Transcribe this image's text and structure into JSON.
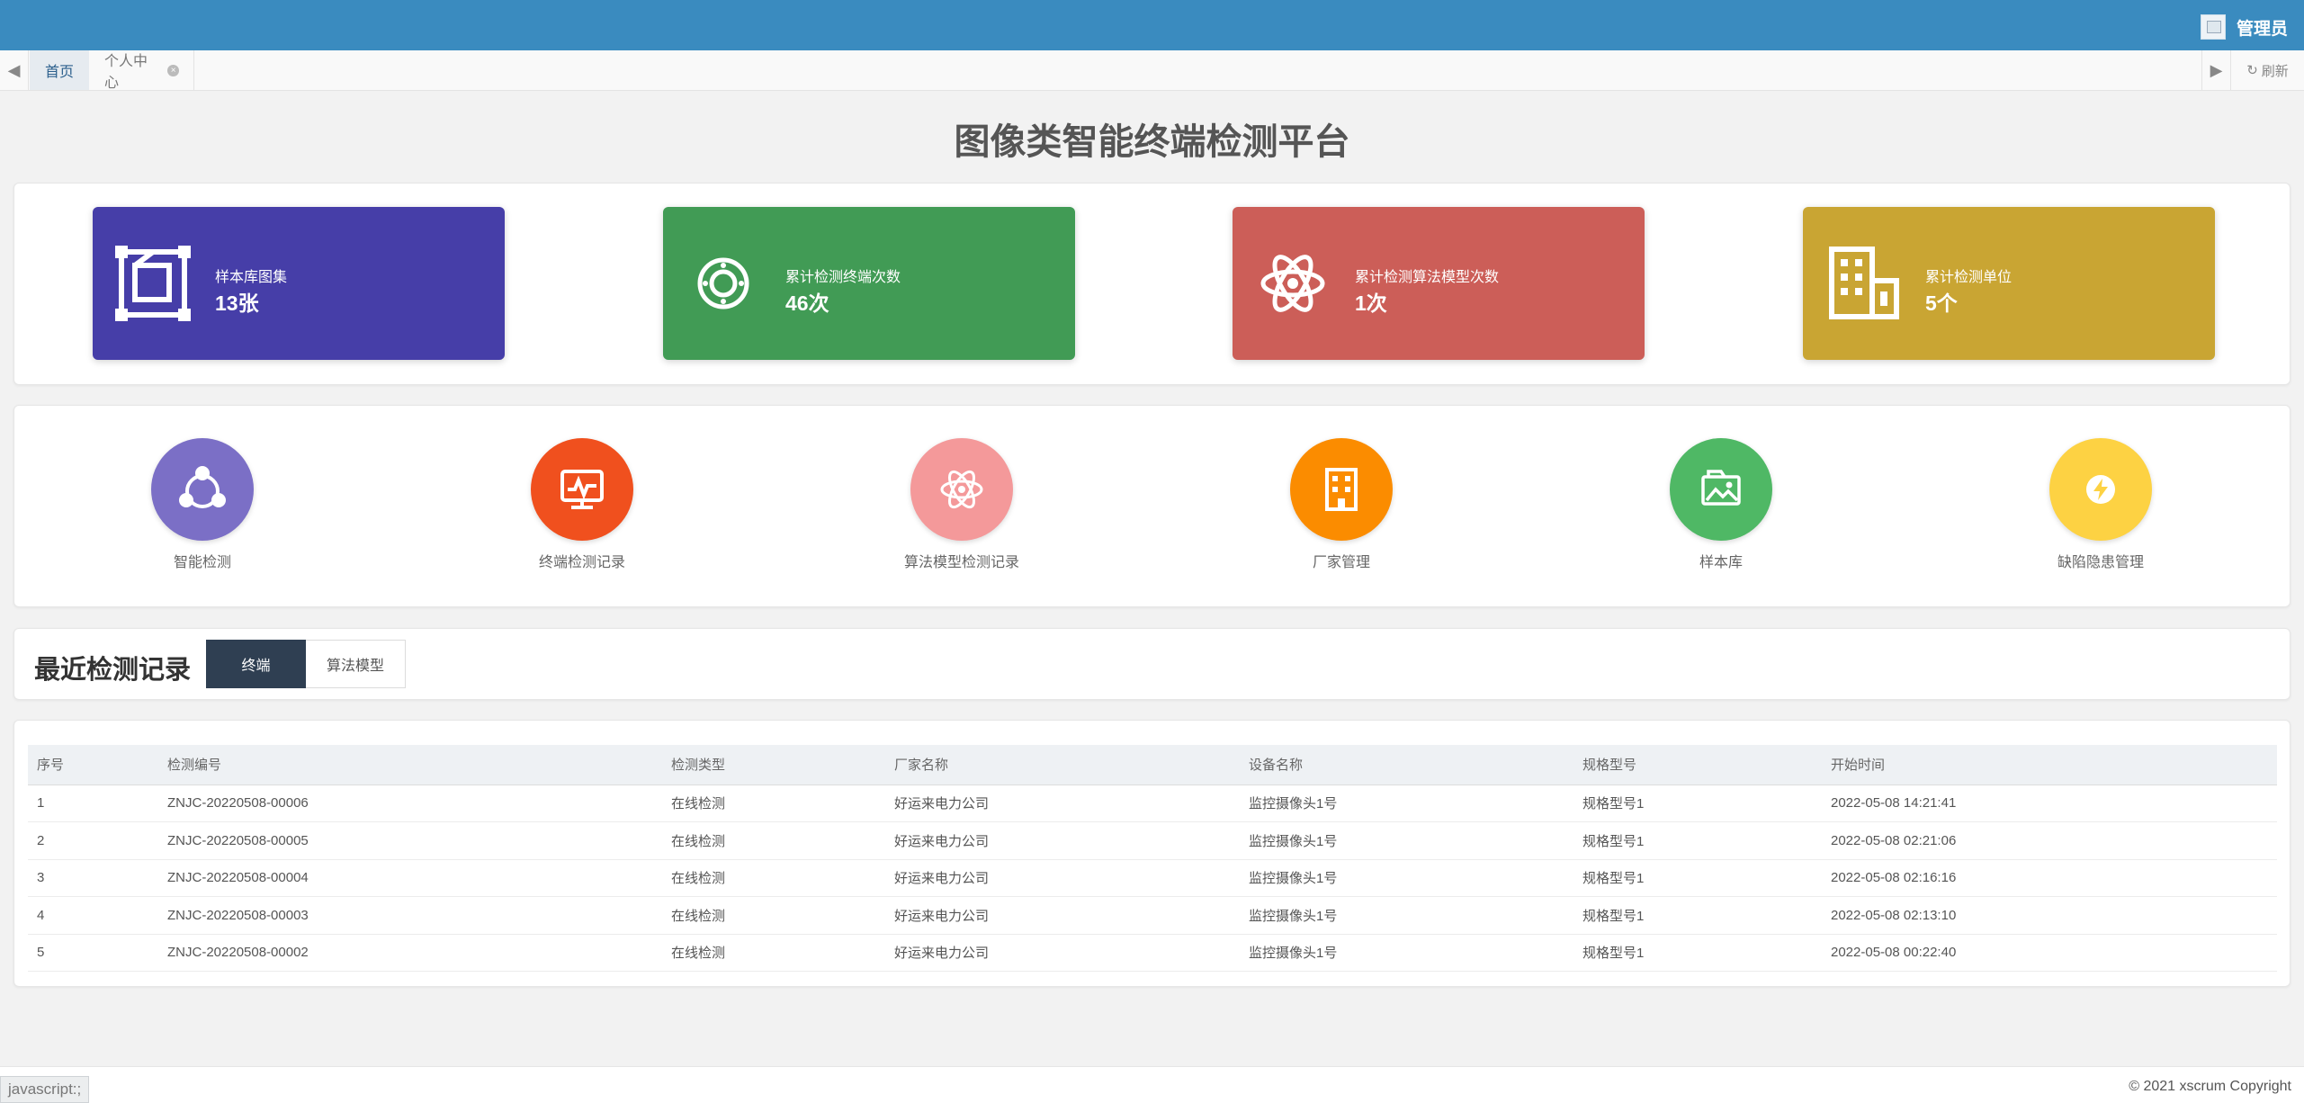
{
  "header": {
    "user_name": "管理员"
  },
  "tabs": {
    "home": "首页",
    "profile": "个人中心",
    "refresh": "刷新"
  },
  "page_title": "图像类智能终端检测平台",
  "stats": [
    {
      "label": "样本库图集",
      "value": "13张",
      "color": "#463ea8",
      "icon": "crop-frame-icon"
    },
    {
      "label": "累计检测终端次数",
      "value": "46次",
      "color": "#419b55",
      "icon": "dial-icon"
    },
    {
      "label": "累计检测算法模型次数",
      "value": "1次",
      "color": "#cc5e58",
      "icon": "atom-icon"
    },
    {
      "label": "累计检测单位",
      "value": "5个",
      "color": "#c9a533",
      "icon": "building-icon"
    }
  ],
  "quick_entries": [
    {
      "label": "智能检测",
      "color": "#7b6fc6",
      "icon": "network-icon"
    },
    {
      "label": "终端检测记录",
      "color": "#f0501e",
      "icon": "monitor-chart-icon"
    },
    {
      "label": "算法模型检测记录",
      "color": "#f4999a",
      "icon": "atom-icon"
    },
    {
      "label": "厂家管理",
      "color": "#fb8c00",
      "icon": "building-icon"
    },
    {
      "label": "样本库",
      "color": "#4fb865",
      "icon": "image-folder-icon"
    },
    {
      "label": "缺陷隐患管理",
      "color": "#fdd243",
      "icon": "lightning-icon"
    }
  ],
  "records": {
    "title": "最近检测记录",
    "tab_terminal": "终端",
    "tab_model": "算法模型",
    "columns": [
      "序号",
      "检测编号",
      "检测类型",
      "厂家名称",
      "设备名称",
      "规格型号",
      "开始时间"
    ],
    "rows": [
      [
        "1",
        "ZNJC-20220508-00006",
        "在线检测",
        "好运来电力公司",
        "监控摄像头1号",
        "规格型号1",
        "2022-05-08 14:21:41"
      ],
      [
        "2",
        "ZNJC-20220508-00005",
        "在线检测",
        "好运来电力公司",
        "监控摄像头1号",
        "规格型号1",
        "2022-05-08 02:21:06"
      ],
      [
        "3",
        "ZNJC-20220508-00004",
        "在线检测",
        "好运来电力公司",
        "监控摄像头1号",
        "规格型号1",
        "2022-05-08 02:16:16"
      ],
      [
        "4",
        "ZNJC-20220508-00003",
        "在线检测",
        "好运来电力公司",
        "监控摄像头1号",
        "规格型号1",
        "2022-05-08 02:13:10"
      ],
      [
        "5",
        "ZNJC-20220508-00002",
        "在线检测",
        "好运来电力公司",
        "监控摄像头1号",
        "规格型号1",
        "2022-05-08 00:22:40"
      ]
    ]
  },
  "footer": {
    "status_text": "javascript:;",
    "copyright": "© 2021 xscrum Copyright"
  }
}
